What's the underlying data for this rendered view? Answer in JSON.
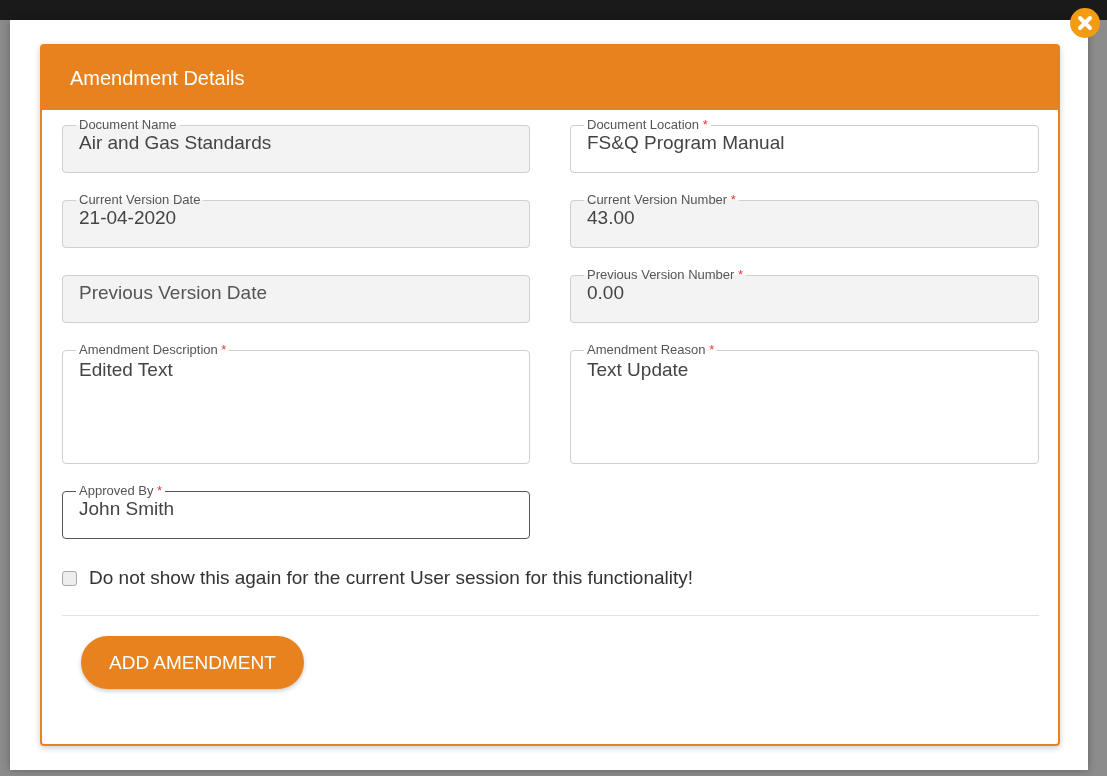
{
  "dialog": {
    "title": "Amendment Details"
  },
  "field_rows": [
    {
      "fields": [
        {
          "kind": "input",
          "label": "Document Name",
          "value": "Air and Gas Standards",
          "readonly": true,
          "focused": false
        },
        {
          "kind": "input",
          "label": "Document Location",
          "required_mark": "*",
          "value": "FS&Q Program Manual",
          "readonly": false,
          "focused": false
        }
      ]
    },
    {
      "fields": [
        {
          "kind": "input",
          "label": "Current Version Date",
          "value": "21-04-2020",
          "readonly": true,
          "focused": false
        },
        {
          "kind": "input",
          "label": "Current Version Number",
          "required_mark": "*",
          "value": "43.00",
          "readonly": true,
          "focused": false
        }
      ]
    },
    {
      "fields": [
        {
          "kind": "input",
          "placeholder": "Previous Version Date",
          "readonly": true,
          "focused": false
        },
        {
          "kind": "input",
          "label": "Previous Version Number",
          "required_mark": "*",
          "value": "0.00",
          "readonly": true,
          "focused": false
        }
      ]
    },
    {
      "fields": [
        {
          "kind": "textarea",
          "label": "Amendment Description",
          "required_mark": "*",
          "value": "Edited Text",
          "readonly": false,
          "focused": false
        },
        {
          "kind": "textarea",
          "label": "Amendment Reason",
          "required_mark": "*",
          "value": "Text Update",
          "readonly": false,
          "focused": false
        }
      ]
    },
    {
      "fields": [
        {
          "kind": "input",
          "label": "Approved By",
          "required_mark": "*",
          "value": "John Smith",
          "readonly": false,
          "focused": true
        }
      ]
    }
  ],
  "checkbox": {
    "label": "Do not show this again for the current User session for this functionality!",
    "checked": false
  },
  "buttons": [
    "ADD AMENDMENT"
  ]
}
